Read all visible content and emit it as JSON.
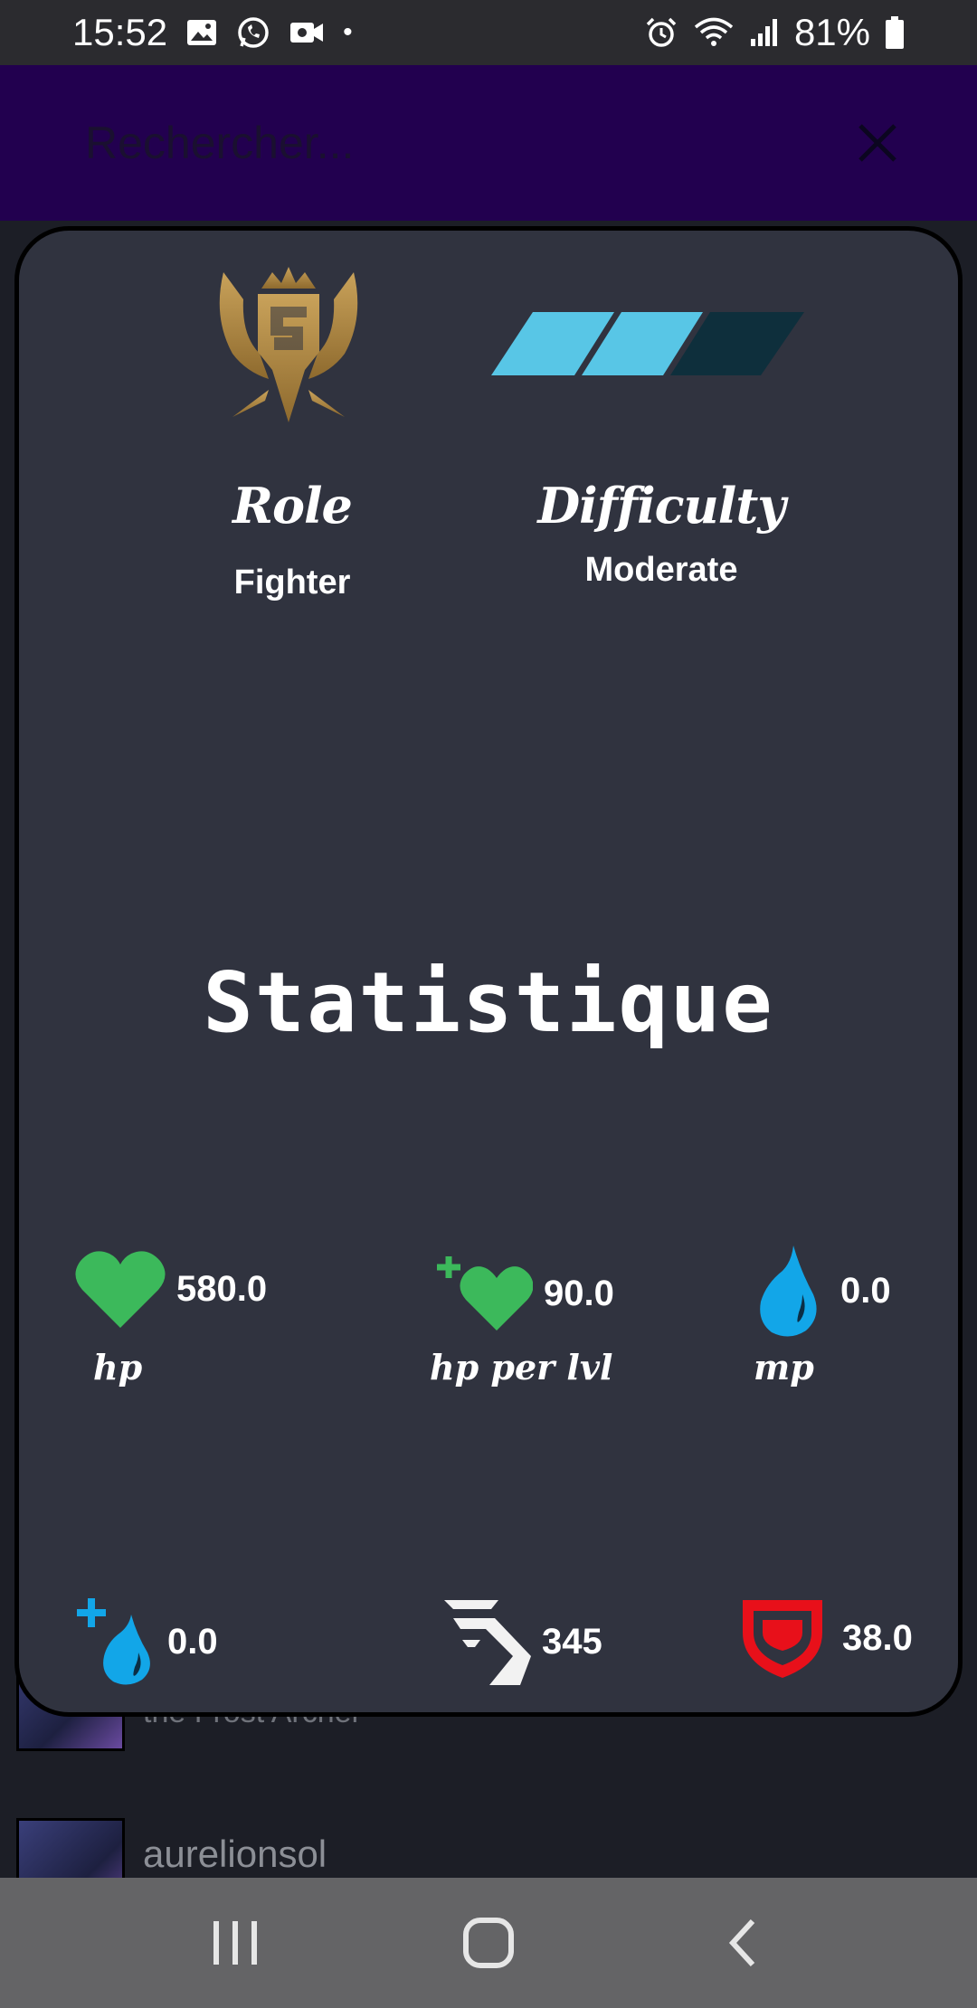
{
  "status_bar": {
    "time": "15:52",
    "dot": "•",
    "battery_percent": "81%",
    "icons": [
      "gallery-icon",
      "whatsapp-icon",
      "video-call-icon",
      "alarm-icon",
      "wifi-icon",
      "signal-icon",
      "battery-icon"
    ]
  },
  "search": {
    "placeholder": "Rechercher..."
  },
  "background_list": [
    {
      "name": "",
      "subtitle": "the Frost Archer"
    },
    {
      "name": "aurelionsol",
      "subtitle": ""
    }
  ],
  "card": {
    "role_label": "Role",
    "role_value": "Fighter",
    "difficulty_label": "Difficulty",
    "difficulty_value": "Moderate",
    "difficulty_level": 2,
    "difficulty_max": 3,
    "stats_title": "Statistique",
    "stats": [
      {
        "key": "hp",
        "value": "580.0",
        "label": "hp",
        "icon": "heart-icon"
      },
      {
        "key": "hpperlevel",
        "value": "90.0",
        "label": "hp per lvl",
        "icon": "heart-plus-icon"
      },
      {
        "key": "mp",
        "value": "0.0",
        "label": "mp",
        "icon": "mana-drop-icon"
      },
      {
        "key": "mpperlevel",
        "value": "0.0",
        "label": "",
        "icon": "mana-plus-icon"
      },
      {
        "key": "movespeed",
        "value": "345",
        "label": "",
        "icon": "move-speed-icon"
      },
      {
        "key": "armor",
        "value": "38.0",
        "label": "",
        "icon": "armor-icon"
      }
    ]
  },
  "colors": {
    "search_bar": "#22004f",
    "card_bg": "#30333f",
    "heart_green": "#3cb95b",
    "mana_blue": "#12a6e8",
    "armor_red": "#e8101a",
    "difficulty_active": "#58c6e6",
    "difficulty_inactive": "#0e2f3c",
    "role_gold": "#b8914a"
  }
}
